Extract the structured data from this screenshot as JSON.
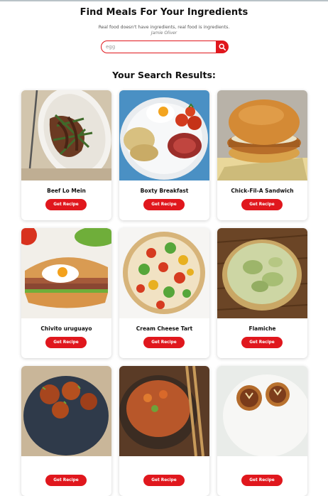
{
  "header": {
    "title": "Find Meals For Your Ingredients",
    "quote": "Real food doesn't have ingredients, real food is ingredients.",
    "author": "Jamie Oliver"
  },
  "search": {
    "value": "egg",
    "placeholder": "egg",
    "button_icon": "search-icon"
  },
  "results": {
    "title": "Your Search Results:",
    "button_label": "Get Recipe",
    "meals": [
      {
        "name": "Beef Lo Mein"
      },
      {
        "name": "Boxty Breakfast"
      },
      {
        "name": "Chick-Fil-A Sandwich"
      },
      {
        "name": "Chivito uruguayo"
      },
      {
        "name": "Cream Cheese Tart"
      },
      {
        "name": "Flamiche"
      },
      {
        "name": ""
      },
      {
        "name": ""
      },
      {
        "name": ""
      }
    ]
  },
  "colors": {
    "accent": "#e0171d",
    "background": "#ffffff"
  }
}
